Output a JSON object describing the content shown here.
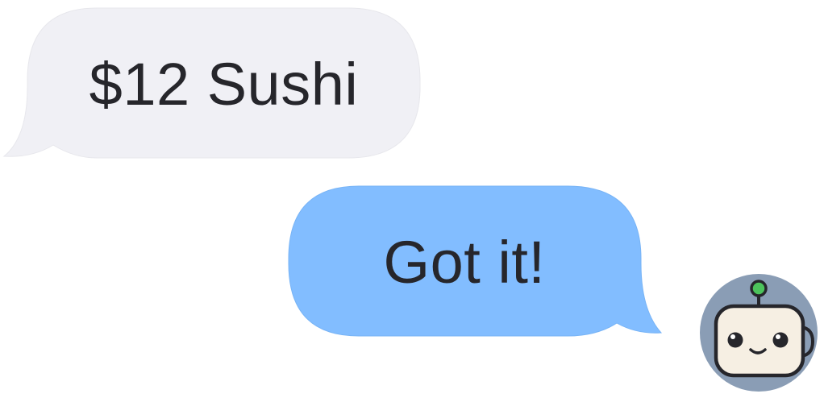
{
  "messages": [
    {
      "direction": "incoming",
      "text": "$12 Sushi",
      "bubble_color": "#f0f0f5"
    },
    {
      "direction": "outgoing",
      "text": "Got it!",
      "bubble_color": "#82bdff"
    }
  ],
  "avatar": {
    "icon": "robot-face-icon",
    "background_color": "#8a9db5",
    "face_color": "#f6efe3",
    "antenna_color": "#4cc35b"
  }
}
